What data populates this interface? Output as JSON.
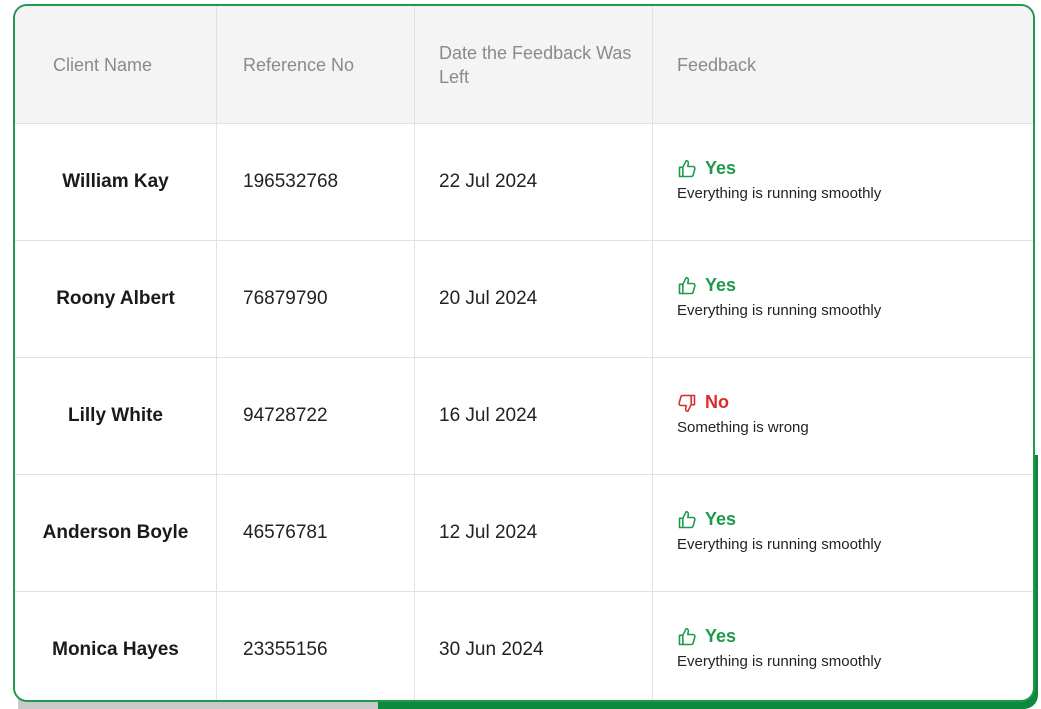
{
  "table": {
    "headers": {
      "client_name": "Client Name",
      "reference_no": "Reference No",
      "date": "Date the Feedback Was Left",
      "feedback": "Feedback"
    },
    "rows": [
      {
        "client": "William Kay",
        "ref": "196532768",
        "date": "22 Jul 2024",
        "feedback": "Yes",
        "positive": true,
        "message": "Everything is running smoothly",
        "icon": "thumbs-up-icon"
      },
      {
        "client": "Roony Albert",
        "ref": "76879790",
        "date": "20 Jul 2024",
        "feedback": "Yes",
        "positive": true,
        "message": "Everything is running smoothly",
        "icon": "thumbs-up-icon"
      },
      {
        "client": "Lilly White",
        "ref": "94728722",
        "date": "16 Jul 2024",
        "feedback": "No",
        "positive": false,
        "message": "Something is wrong",
        "icon": "thumbs-down-icon"
      },
      {
        "client": "Anderson Boyle",
        "ref": "46576781",
        "date": "12 Jul 2024",
        "feedback": "Yes",
        "positive": true,
        "message": "Everything is running smoothly",
        "icon": "thumbs-up-icon"
      },
      {
        "client": "Monica Hayes",
        "ref": "23355156",
        "date": "30 Jun 2024",
        "feedback": "Yes",
        "positive": true,
        "message": "Everything is running smoothly",
        "icon": "thumbs-up-icon"
      }
    ]
  },
  "colors": {
    "accent_green": "#1e9a4a",
    "negative_red": "#d92c2c",
    "header_bg": "#f4f4f4"
  }
}
